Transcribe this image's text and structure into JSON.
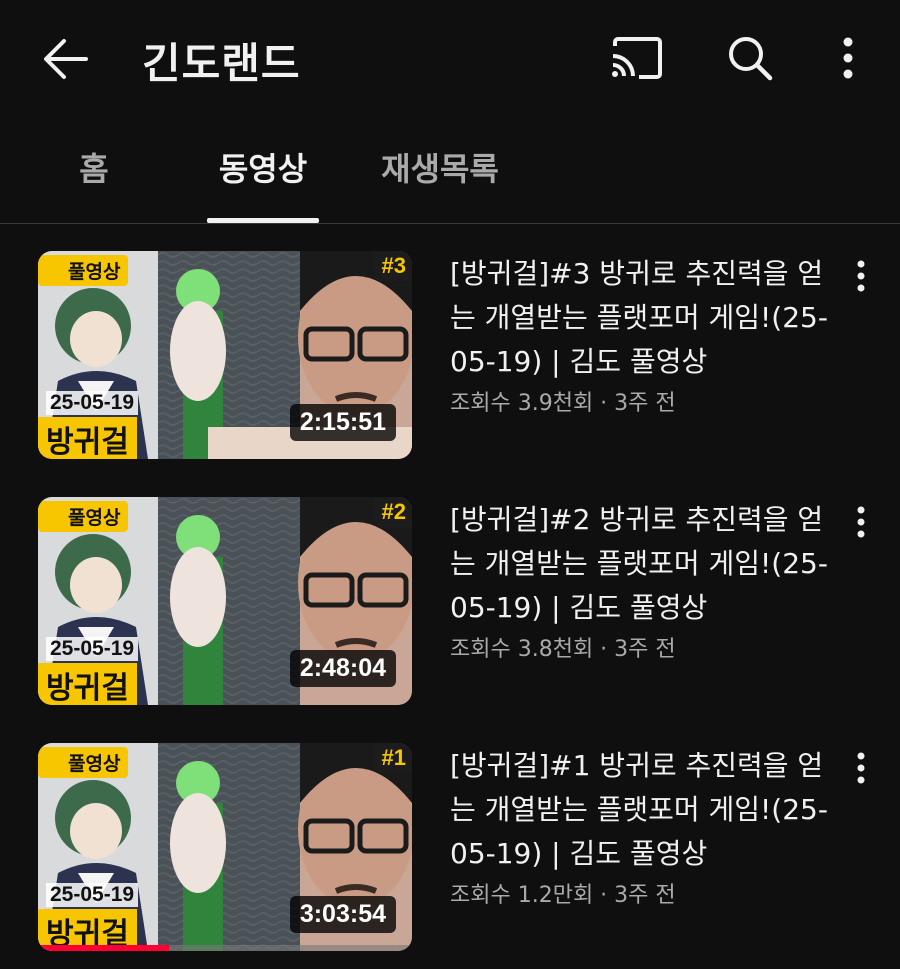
{
  "header": {
    "title": "긴도랜드",
    "icons": [
      "back-arrow-icon",
      "cast-icon",
      "search-icon",
      "more-vert-icon"
    ]
  },
  "tabs": [
    {
      "label": "홈",
      "selected": false
    },
    {
      "label": "동영상",
      "selected": true
    },
    {
      "label": "재생목록",
      "selected": false
    }
  ],
  "videos": [
    {
      "title": "[방귀걸]#3 방귀로 추진력을 얻는 개열받는 플랫포머 게임!(25-05-19) | 김도 풀영상",
      "views": "조회수 3.9천회",
      "age": "3주 전",
      "duration": "2:15:51",
      "thumb_badge": "풀영상",
      "thumb_episode": "#3",
      "thumb_date": "25-05-19",
      "thumb_game": "방귀걸",
      "watched_fraction": 0
    },
    {
      "title": "[방귀걸]#2 방귀로 추진력을 얻는 개열받는 플랫포머 게임!(25-05-19) | 김도 풀영상",
      "views": "조회수 3.8천회",
      "age": "3주 전",
      "duration": "2:48:04",
      "thumb_badge": "풀영상",
      "thumb_episode": "#2",
      "thumb_date": "25-05-19",
      "thumb_game": "방귀걸",
      "watched_fraction": 0
    },
    {
      "title": "[방귀걸]#1 방귀로 추진력을 얻는 개열받는 플랫포머 게임!(25-05-19) | 김도 풀영상",
      "views": "조회수 1.2만회",
      "age": "3주 전",
      "duration": "3:03:54",
      "thumb_badge": "풀영상",
      "thumb_episode": "#1",
      "thumb_date": "25-05-19",
      "thumb_game": "방귀걸",
      "watched_fraction": 0.35
    }
  ],
  "colors": {
    "background": "#0f0f0f",
    "text_primary": "#f1f1f1",
    "text_secondary": "#aaaaaa",
    "progress": "#ff0033",
    "thumb_accent": "#f7c600"
  }
}
